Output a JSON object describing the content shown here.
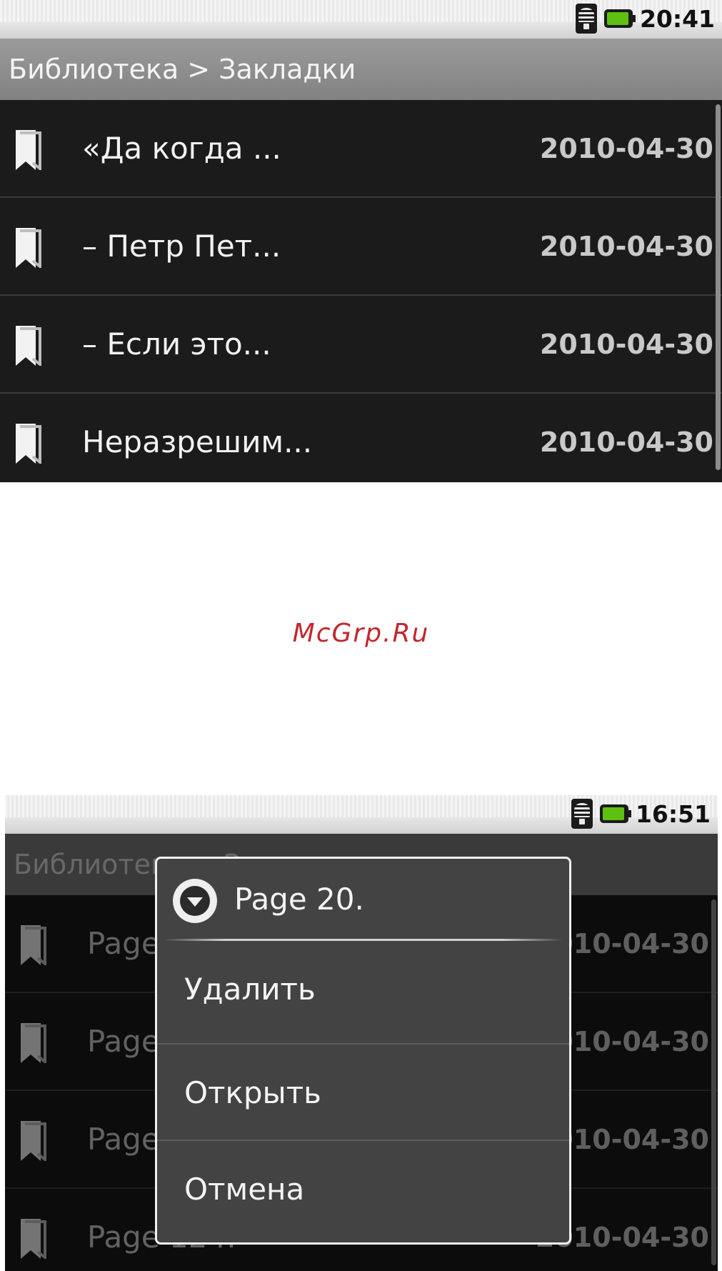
{
  "screen1": {
    "status": {
      "time": "20:41"
    },
    "breadcrumb": "Библиотека > Закладки",
    "bookmarks": [
      {
        "title": "«Да когда ...",
        "date": "2010-04-30"
      },
      {
        "title": "– Петр Пет...",
        "date": "2010-04-30"
      },
      {
        "title": "– Если это...",
        "date": "2010-04-30"
      },
      {
        "title": "Неразрешим...",
        "date": "2010-04-30"
      }
    ]
  },
  "watermark": "McGrp.Ru",
  "screen2": {
    "status": {
      "time": "16:51"
    },
    "breadcrumb": "Библиотека > Закладки",
    "bookmarks": [
      {
        "title": "Page 20.",
        "date": "2010-04-30"
      },
      {
        "title": "Page 59.",
        "date": "2010-04-30"
      },
      {
        "title": "Page 84.",
        "date": "2010-04-30"
      },
      {
        "title": "Page 124.",
        "date": "2010-04-30"
      }
    ],
    "dialog": {
      "title": "Page 20.",
      "options": [
        "Удалить",
        "Открыть",
        "Отмена"
      ]
    }
  }
}
